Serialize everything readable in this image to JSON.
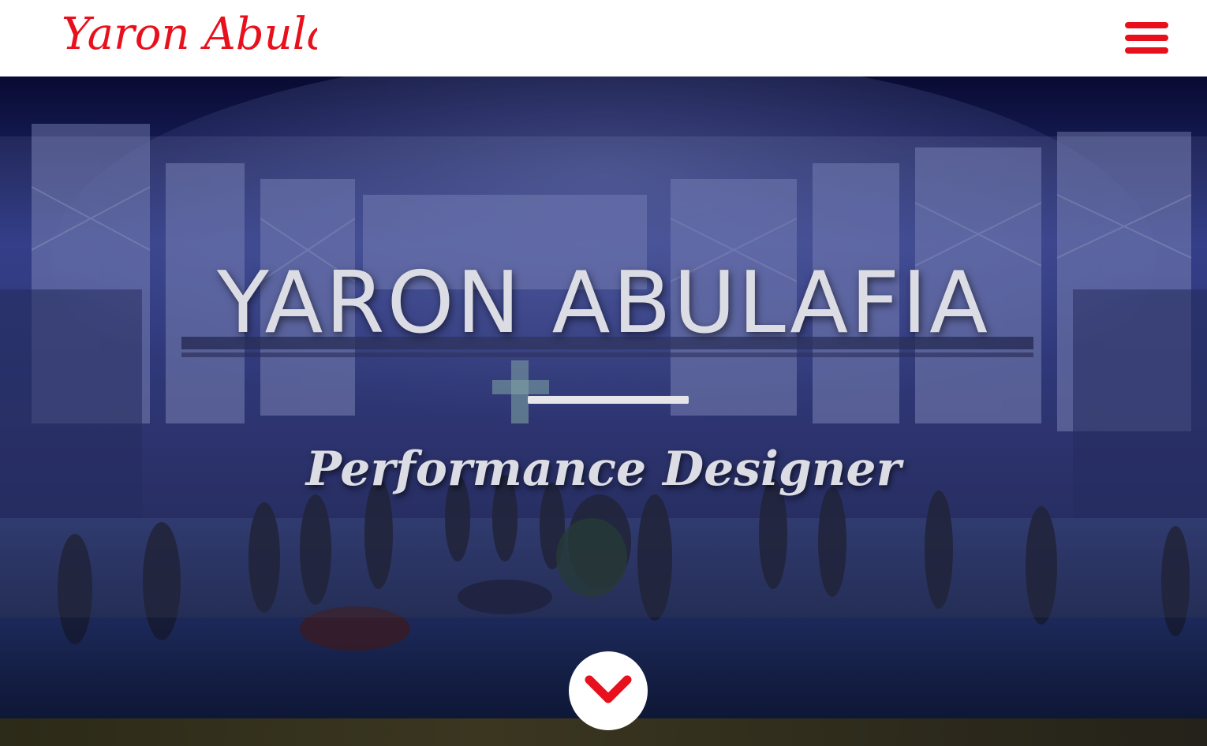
{
  "header": {
    "logo_text": "Yaron Abulafia",
    "menu_icon": "hamburger-menu-icon"
  },
  "hero": {
    "title": "YARON ABULAFIA",
    "subtitle": "Performance Designer",
    "scroll_icon": "chevron-down-icon"
  },
  "colors": {
    "brand_red": "#e8101c",
    "title_text": "#dcdde4",
    "stage_blue": "#2a3a8a"
  }
}
